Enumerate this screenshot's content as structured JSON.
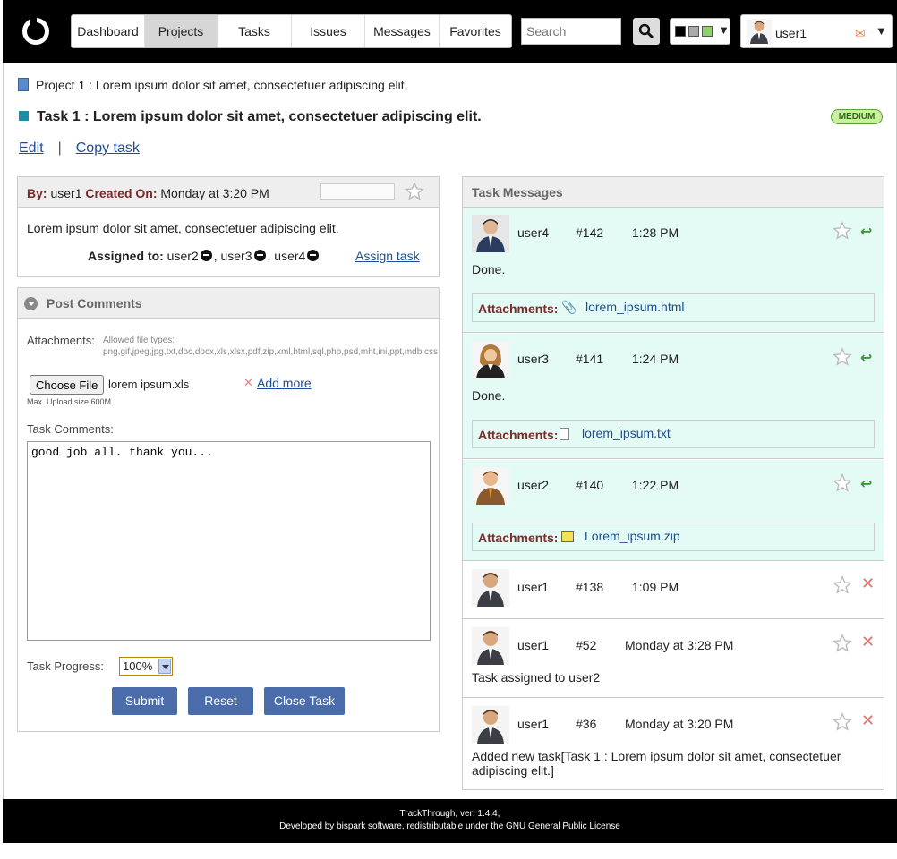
{
  "nav": {
    "items": [
      {
        "label": "Dashboard"
      },
      {
        "label": "Projects"
      },
      {
        "label": "Tasks"
      },
      {
        "label": "Issues"
      },
      {
        "label": "Messages"
      },
      {
        "label": "Favorites"
      }
    ],
    "active": "Projects",
    "search_placeholder": "Search",
    "user": "user1",
    "theme_colors": [
      "#000000",
      "#aaaaaa",
      "#8fd16b"
    ]
  },
  "project_line": "Project 1 : Lorem ipsum dolor sit amet, consectetuer adipiscing elit.",
  "task": {
    "title": "Task 1 : Lorem ipsum dolor sit amet, consectetuer adipiscing elit.",
    "priority": "MEDIUM",
    "edit_label": "Edit",
    "sep": "|",
    "copy_label": "Copy task",
    "by_label": "By:",
    "by_user": "user1",
    "created_label": "Created On:",
    "created_on": "Monday at 3:20 PM",
    "description": "Lorem ipsum dolor sit amet, consectetuer adipiscing elit.",
    "assigned_label": "Assigned to:",
    "assignees": [
      "user2",
      "user3",
      "user4"
    ],
    "assign_link": "Assign task"
  },
  "post": {
    "title": "Post Comments",
    "attachments_label": "Attachments:",
    "allowed_types": "Allowed file types: png,gif,jpeg,jpg,txt,doc,docx,xls,xlsx,pdf,zip,xml,html,sql,php,psd,mht,ini,ppt,mdb,css",
    "choose_file": "Choose File",
    "file_name": "lorem ipsum.xls",
    "add_more": "Add more",
    "max_upload": "Max. Upload size 600M.",
    "comments_label": "Task Comments:",
    "comment_value": "good job all. thank you...",
    "progress_label": "Task Progress:",
    "progress_value": "100%",
    "submit": "Submit",
    "reset": "Reset",
    "close": "Close Task"
  },
  "messages": {
    "title": "Task Messages",
    "attachments_label": "Attachments:",
    "items": [
      {
        "user": "user4",
        "num": "#142",
        "time": "1:28 PM",
        "text": "Done.",
        "attachment": "lorem_ipsum.html"
      },
      {
        "user": "user3",
        "num": "#141",
        "time": "1:24 PM",
        "text": "Done.",
        "attachment": "lorem_ipsum.txt"
      },
      {
        "user": "user2",
        "num": "#140",
        "time": "1:22 PM",
        "attachment": "Lorem_ipsum.zip"
      },
      {
        "user": "user1",
        "num": "#138",
        "time": "1:09 PM"
      },
      {
        "user": "user1",
        "num": "#52",
        "time": "Monday at 3:28 PM",
        "text": "Task assigned to user2"
      },
      {
        "user": "user1",
        "num": "#36",
        "time": "Monday at 3:20 PM",
        "text": "Added new task[Task 1 : Lorem ipsum dolor sit amet, consectetuer adipiscing elit.]"
      }
    ]
  },
  "footer": {
    "line1": "TrackThrough, ver: 1.4.4,",
    "line2": "Developed by bispark software, redistributable under the GNU General Public License"
  }
}
